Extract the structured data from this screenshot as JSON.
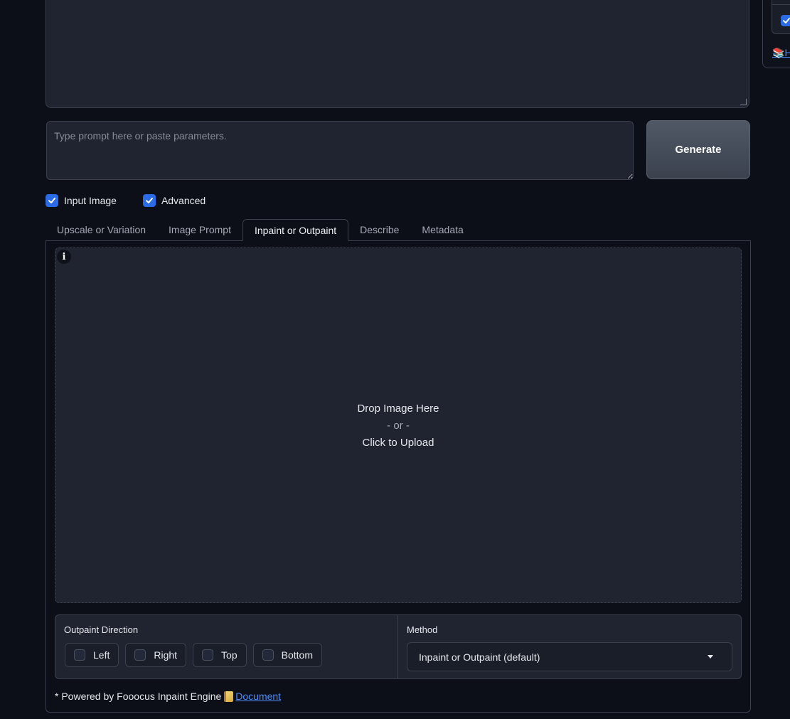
{
  "prompt": {
    "placeholder": "Type prompt here or paste parameters.",
    "generate_label": "Generate"
  },
  "toggles": [
    {
      "label": "Input Image",
      "checked": true
    },
    {
      "label": "Advanced",
      "checked": true
    }
  ],
  "side_panel": {
    "link_text": "H"
  },
  "tabs": [
    {
      "label": "Upscale or Variation",
      "active": false
    },
    {
      "label": "Image Prompt",
      "active": false
    },
    {
      "label": "Inpaint or Outpaint",
      "active": true
    },
    {
      "label": "Describe",
      "active": false
    },
    {
      "label": "Metadata",
      "active": false
    }
  ],
  "upload": {
    "info": "i",
    "drop_text": "Drop Image Here",
    "or_text": "- or -",
    "click_text": "Click to Upload"
  },
  "outpaint": {
    "label": "Outpaint Direction",
    "directions": [
      "Left",
      "Right",
      "Top",
      "Bottom"
    ]
  },
  "method": {
    "label": "Method",
    "selected": "Inpaint or Outpaint (default)"
  },
  "footer": {
    "text": "* Powered by Fooocus Inpaint Engine",
    "link": "Document"
  },
  "colors": {
    "accent": "#2b6be6",
    "link": "#4a8cff",
    "background": "#0c0f17",
    "panel": "#1f2430"
  }
}
